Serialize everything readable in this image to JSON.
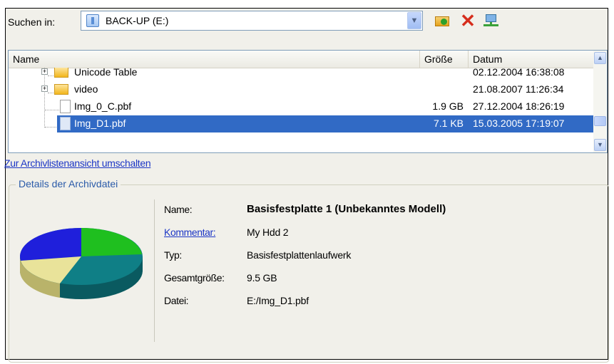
{
  "toolbar": {
    "look_in_label": "Suchen in:",
    "location": "BACK-UP (E:)",
    "icons": {
      "drive": "drive-icon",
      "dropdown": "chevron-down-icon",
      "new_folder": "new-folder-icon",
      "delete": "delete-icon",
      "network": "network-drive-icon"
    }
  },
  "file_list": {
    "columns": [
      "Name",
      "Größe",
      "Datum"
    ],
    "rows": [
      {
        "name": "Unicode Table",
        "size": "",
        "date": "02.12.2004 16:38:08",
        "type": "folder",
        "expandable": true,
        "selected": false
      },
      {
        "name": "video",
        "size": "",
        "date": "21.08.2007 11:26:34",
        "type": "folder",
        "expandable": true,
        "selected": false
      },
      {
        "name": "Img_0_C.pbf",
        "size": "1.9 GB",
        "date": "27.12.2004 18:26:19",
        "type": "file",
        "expandable": false,
        "selected": false
      },
      {
        "name": "Img_D1.pbf",
        "size": "7.1 KB",
        "date": "15.03.2005 17:19:07",
        "type": "file",
        "expandable": false,
        "selected": true
      }
    ]
  },
  "switch_view_link": "Zur Archivlistenansicht umschalten",
  "details": {
    "legend": "Details der Archivdatei",
    "name_label": "Name:",
    "name_value": "Basisfestplatte 1 (Unbekanntes Modell)",
    "comment_label": "Kommentar:",
    "comment_value": "My Hdd 2",
    "type_label": "Typ:",
    "type_value": "Basisfestplattenlaufwerk",
    "total_size_label": "Gesamtgröße:",
    "total_size_value": "9.5 GB",
    "file_label": "Datei:",
    "file_value": "E:/Img_D1.pbf",
    "pie_icon": "disk-usage-pie-icon",
    "pie_colors": [
      "#1fbf1f",
      "#1f1fdb",
      "#e9e39a",
      "#0f7f86"
    ]
  },
  "colors": {
    "selection": "#316ac5",
    "link": "#1c36c6",
    "window_bg": "#f1f0ea"
  }
}
